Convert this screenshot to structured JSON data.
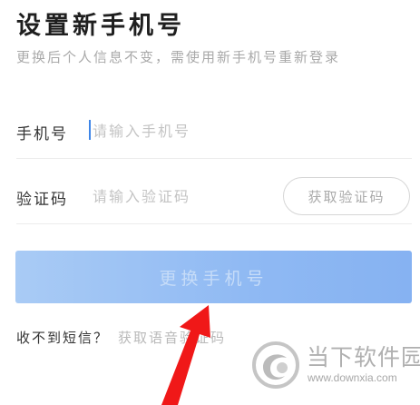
{
  "header": {
    "title": "设置新手机号",
    "subtitle": "更换后个人信息不变，需使用新手机号重新登录"
  },
  "form": {
    "phone_label": "手机号",
    "phone_placeholder": "请输入手机号",
    "phone_value": "",
    "code_label": "验证码",
    "code_placeholder": "请输入验证码",
    "code_value": "",
    "get_code_label": "获取验证码",
    "submit_label": "更换手机号"
  },
  "help": {
    "no_sms_text": "收不到短信？",
    "voice_code_link": "获取语音验证码"
  },
  "watermark": {
    "logo_icon": "downxia-logo-icon",
    "name": "当下软件园",
    "url": "www.downxia.com"
  },
  "annotation": {
    "arrow_icon": "red-arrow-icon",
    "arrow_color": "#f01818"
  },
  "colors": {
    "accent": "#3f86e8",
    "submit_gradient_start": "#a9cbf5",
    "submit_gradient_end": "#86b2f2"
  }
}
